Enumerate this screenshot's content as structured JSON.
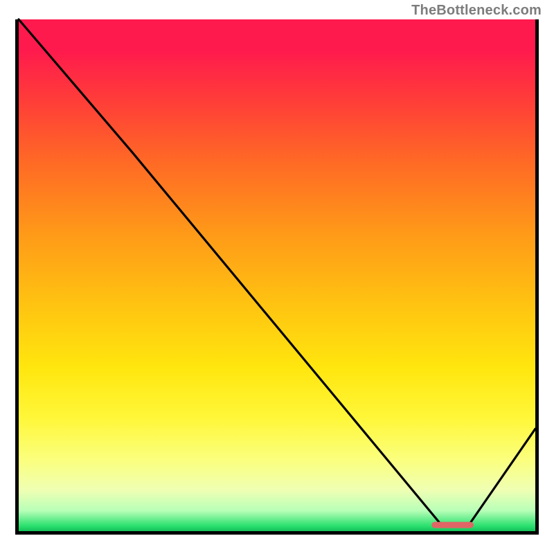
{
  "attribution": "TheBottleneck.com",
  "chart_data": {
    "type": "line",
    "title": "",
    "xlabel": "",
    "ylabel": "",
    "xlim": [
      0,
      100
    ],
    "ylim": [
      0,
      100
    ],
    "grid": false,
    "legend": false,
    "x": [
      0,
      22,
      82,
      87,
      100
    ],
    "values": [
      100,
      74,
      1,
      1,
      20
    ],
    "marker": {
      "x_range": [
        80,
        88
      ],
      "y": 1.2
    },
    "gradient_stops": [
      {
        "pos": 0,
        "color": "#ff1a4e"
      },
      {
        "pos": 15,
        "color": "#ff3a3a"
      },
      {
        "pos": 28,
        "color": "#ff6a25"
      },
      {
        "pos": 42,
        "color": "#ff9a18"
      },
      {
        "pos": 56,
        "color": "#ffc411"
      },
      {
        "pos": 68,
        "color": "#ffe60e"
      },
      {
        "pos": 78,
        "color": "#fff73a"
      },
      {
        "pos": 86,
        "color": "#fbff7d"
      },
      {
        "pos": 92,
        "color": "#efffb3"
      },
      {
        "pos": 96,
        "color": "#b8ffb8"
      },
      {
        "pos": 99,
        "color": "#29e06d"
      },
      {
        "pos": 100,
        "color": "#14c25a"
      }
    ]
  }
}
